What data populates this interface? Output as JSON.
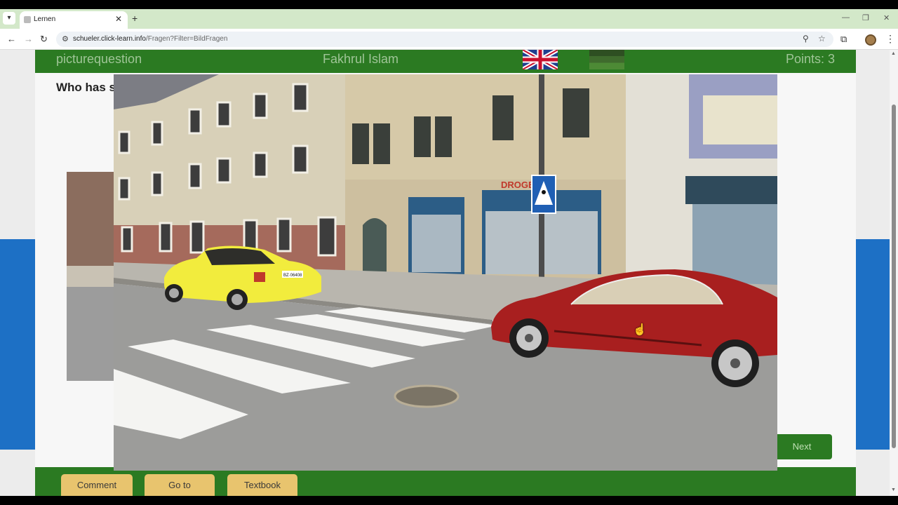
{
  "browser": {
    "tab_title": "Lernen",
    "url_host": "schueler.click-learn.info",
    "url_path": "/Fragen?Filter=BildFragen",
    "icons": [
      "tab-list-icon",
      "back-icon",
      "forward-icon",
      "reload-icon",
      "site-info-icon",
      "zoom-icon",
      "bookmark-star-icon",
      "extensions-icon",
      "menu-icon"
    ]
  },
  "header": {
    "mode": "picturequestion",
    "user_name": "Fakhrul Islam",
    "points": "Points: 3"
  },
  "question": {
    "text": "Who has s"
  },
  "actions": {
    "next": "Next"
  },
  "footer": {
    "comment": "Comment",
    "goto": "Go to",
    "textbook": "Textbook"
  },
  "scene": {
    "shop_sign": "DROGERIE",
    "plate": "BZ·06408"
  },
  "colors": {
    "header_green": "#2b7a22",
    "header_text": "#9fc597",
    "footer_button": "#e8c46e",
    "side_blue": "#1d70c5"
  }
}
